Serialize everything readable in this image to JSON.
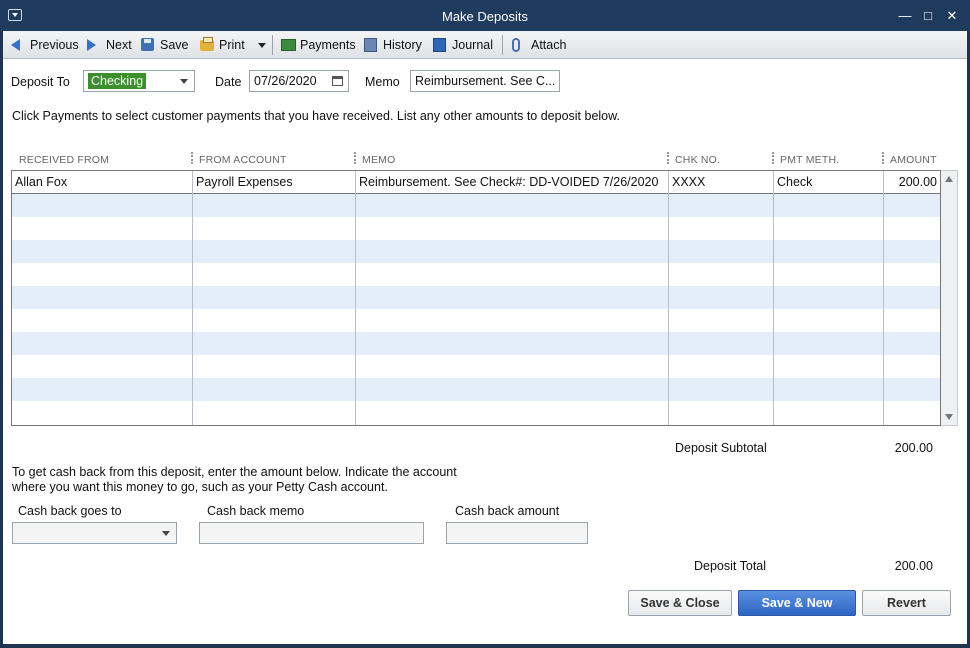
{
  "window": {
    "title": "Make Deposits"
  },
  "toolbar": {
    "previous": "Previous",
    "next": "Next",
    "save": "Save",
    "print": "Print",
    "payments": "Payments",
    "history": "History",
    "journal": "Journal",
    "attach": "Attach"
  },
  "form": {
    "deposit_to_label": "Deposit To",
    "deposit_to_value": "Checking",
    "date_label": "Date",
    "date_value": "07/26/2020",
    "memo_label": "Memo",
    "memo_value": "Reimbursement. See C...",
    "instructions": "Click Payments to select customer payments that you have received. List any other amounts to deposit below."
  },
  "table": {
    "columns": [
      "RECEIVED FROM",
      "FROM ACCOUNT",
      "MEMO",
      "CHK NO.",
      "PMT METH.",
      "AMOUNT"
    ],
    "rows": [
      {
        "received_from": "Allan Fox",
        "from_account": "Payroll Expenses",
        "memo": "Reimbursement. See Check#: DD-VOIDED 7/26/2020",
        "chk_no": "XXXX",
        "pmt_meth": "Check",
        "amount": "200.00"
      }
    ]
  },
  "totals": {
    "subtotal_label": "Deposit Subtotal",
    "subtotal_value": "200.00",
    "total_label": "Deposit Total",
    "total_value": "200.00"
  },
  "cashback": {
    "instructions_line1": "To get cash back from this deposit, enter the amount below.  Indicate the account",
    "instructions_line2": "where you want this money to go, such as your Petty Cash account.",
    "goes_to_label": "Cash back goes to",
    "memo_label": "Cash back memo",
    "amount_label": "Cash back amount"
  },
  "buttons": {
    "save_close": "Save & Close",
    "save_new": "Save & New",
    "revert": "Revert"
  },
  "colors": {
    "titlebar": "#1f3b5e",
    "row_alt": "#e4eefb",
    "selection_green": "#3b8f2c",
    "primary_button": "#2f66c4"
  }
}
